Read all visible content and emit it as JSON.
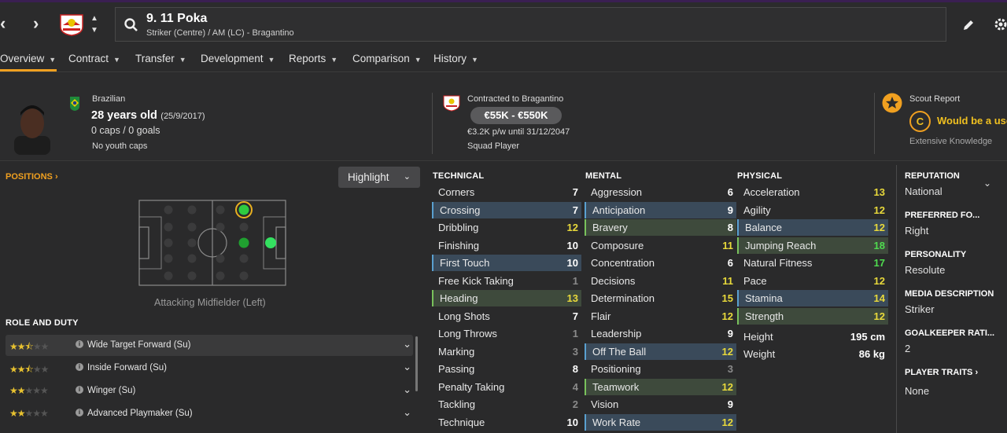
{
  "header": {
    "player_name": "9. 11 Poka",
    "player_sub": "Striker (Centre) / AM (LC) - Bragantino",
    "nav_prev": "‹",
    "nav_next": "›",
    "icons": [
      "search-icon",
      "edit-icon",
      "settings-icon",
      "club-badge"
    ]
  },
  "tabs": [
    {
      "label": "Overview"
    },
    {
      "label": "Contract"
    },
    {
      "label": "Transfer"
    },
    {
      "label": "Development"
    },
    {
      "label": "Reports"
    },
    {
      "label": "Comparison"
    },
    {
      "label": "History"
    }
  ],
  "info": {
    "nationality": "Brazilian",
    "age": "28 years old",
    "dob": "(25/9/2017)",
    "caps": "0 caps / 0 goals",
    "youth_caps": "No youth caps",
    "contract_club": "Contracted to Bragantino",
    "value_range": "€55K - €550K",
    "wage": "€3.2K p/w until 31/12/2047",
    "squad_status": "Squad Player",
    "scout_report_title": "Scout Report",
    "scout_grade": "C",
    "scout_text": "Would be a use",
    "scout_knowledge": "Extensive Knowledge"
  },
  "positions": {
    "title": "POSITIONS",
    "highlight_label": "Highlight",
    "position_label": "Attacking Midfielder (Left)"
  },
  "role_duty": {
    "title": "ROLE AND DUTY",
    "roles": [
      {
        "label": "Wide Target Forward (Su)",
        "stars": 2.5
      },
      {
        "label": "Inside Forward (Su)",
        "stars": 2.5
      },
      {
        "label": "Winger (Su)",
        "stars": 2
      },
      {
        "label": "Advanced Playmaker (Su)",
        "stars": 2
      }
    ]
  },
  "attributes": {
    "technical_title": "TECHNICAL",
    "mental_title": "MENTAL",
    "physical_title": "PHYSICAL",
    "technical": [
      {
        "name": "Corners",
        "value": "7",
        "hl": "",
        "color": "white"
      },
      {
        "name": "Crossing",
        "value": "7",
        "hl": "blue",
        "color": "white"
      },
      {
        "name": "Dribbling",
        "value": "12",
        "hl": "",
        "color": "yellow"
      },
      {
        "name": "Finishing",
        "value": "10",
        "hl": "",
        "color": "white"
      },
      {
        "name": "First Touch",
        "value": "10",
        "hl": "blue",
        "color": "white"
      },
      {
        "name": "Free Kick Taking",
        "value": "1",
        "hl": "",
        "color": "grey"
      },
      {
        "name": "Heading",
        "value": "13",
        "hl": "green",
        "color": "yellow"
      },
      {
        "name": "Long Shots",
        "value": "7",
        "hl": "",
        "color": "white"
      },
      {
        "name": "Long Throws",
        "value": "1",
        "hl": "",
        "color": "grey"
      },
      {
        "name": "Marking",
        "value": "3",
        "hl": "",
        "color": "grey"
      },
      {
        "name": "Passing",
        "value": "8",
        "hl": "",
        "color": "white"
      },
      {
        "name": "Penalty Taking",
        "value": "4",
        "hl": "",
        "color": "grey"
      },
      {
        "name": "Tackling",
        "value": "2",
        "hl": "",
        "color": "grey"
      },
      {
        "name": "Technique",
        "value": "10",
        "hl": "",
        "color": "white"
      }
    ],
    "mental": [
      {
        "name": "Aggression",
        "value": "6",
        "hl": "",
        "color": "white"
      },
      {
        "name": "Anticipation",
        "value": "9",
        "hl": "blue",
        "color": "white"
      },
      {
        "name": "Bravery",
        "value": "8",
        "hl": "green",
        "color": "white"
      },
      {
        "name": "Composure",
        "value": "11",
        "hl": "",
        "color": "yellow"
      },
      {
        "name": "Concentration",
        "value": "6",
        "hl": "",
        "color": "white"
      },
      {
        "name": "Decisions",
        "value": "11",
        "hl": "",
        "color": "yellow"
      },
      {
        "name": "Determination",
        "value": "15",
        "hl": "",
        "color": "yellow"
      },
      {
        "name": "Flair",
        "value": "12",
        "hl": "",
        "color": "yellow"
      },
      {
        "name": "Leadership",
        "value": "9",
        "hl": "",
        "color": "white"
      },
      {
        "name": "Off The Ball",
        "value": "12",
        "hl": "blue",
        "color": "yellow"
      },
      {
        "name": "Positioning",
        "value": "3",
        "hl": "",
        "color": "grey"
      },
      {
        "name": "Teamwork",
        "value": "12",
        "hl": "green",
        "color": "yellow"
      },
      {
        "name": "Vision",
        "value": "9",
        "hl": "",
        "color": "white"
      },
      {
        "name": "Work Rate",
        "value": "12",
        "hl": "blue",
        "color": "yellow"
      }
    ],
    "physical": [
      {
        "name": "Acceleration",
        "value": "13",
        "hl": "",
        "color": "yellow"
      },
      {
        "name": "Agility",
        "value": "12",
        "hl": "",
        "color": "yellow"
      },
      {
        "name": "Balance",
        "value": "12",
        "hl": "blue",
        "color": "yellow"
      },
      {
        "name": "Jumping Reach",
        "value": "18",
        "hl": "green",
        "color": "green"
      },
      {
        "name": "Natural Fitness",
        "value": "17",
        "hl": "",
        "color": "green"
      },
      {
        "name": "Pace",
        "value": "12",
        "hl": "",
        "color": "yellow"
      },
      {
        "name": "Stamina",
        "value": "14",
        "hl": "blue",
        "color": "yellow"
      },
      {
        "name": "Strength",
        "value": "12",
        "hl": "green",
        "color": "yellow"
      }
    ],
    "height_label": "Height",
    "height": "195 cm",
    "weight_label": "Weight",
    "weight": "86 kg"
  },
  "right_panel": [
    {
      "title": "REPUTATION",
      "value": "National"
    },
    {
      "title": "PREFERRED FO...",
      "value": "Right"
    },
    {
      "title": "PERSONALITY",
      "value": "Resolute"
    },
    {
      "title": "MEDIA DESCRIPTION",
      "value": "Striker"
    },
    {
      "title": "GOALKEEPER RATI...",
      "value": "2"
    },
    {
      "title": "PLAYER TRAITS",
      "value": "None"
    }
  ],
  "colors": {
    "accent": "#f0a020",
    "blue_hl": "#3a4a5a",
    "green_hl": "#3e4a3c",
    "yellow": "#e8d93b",
    "green": "#4fdb4f"
  }
}
